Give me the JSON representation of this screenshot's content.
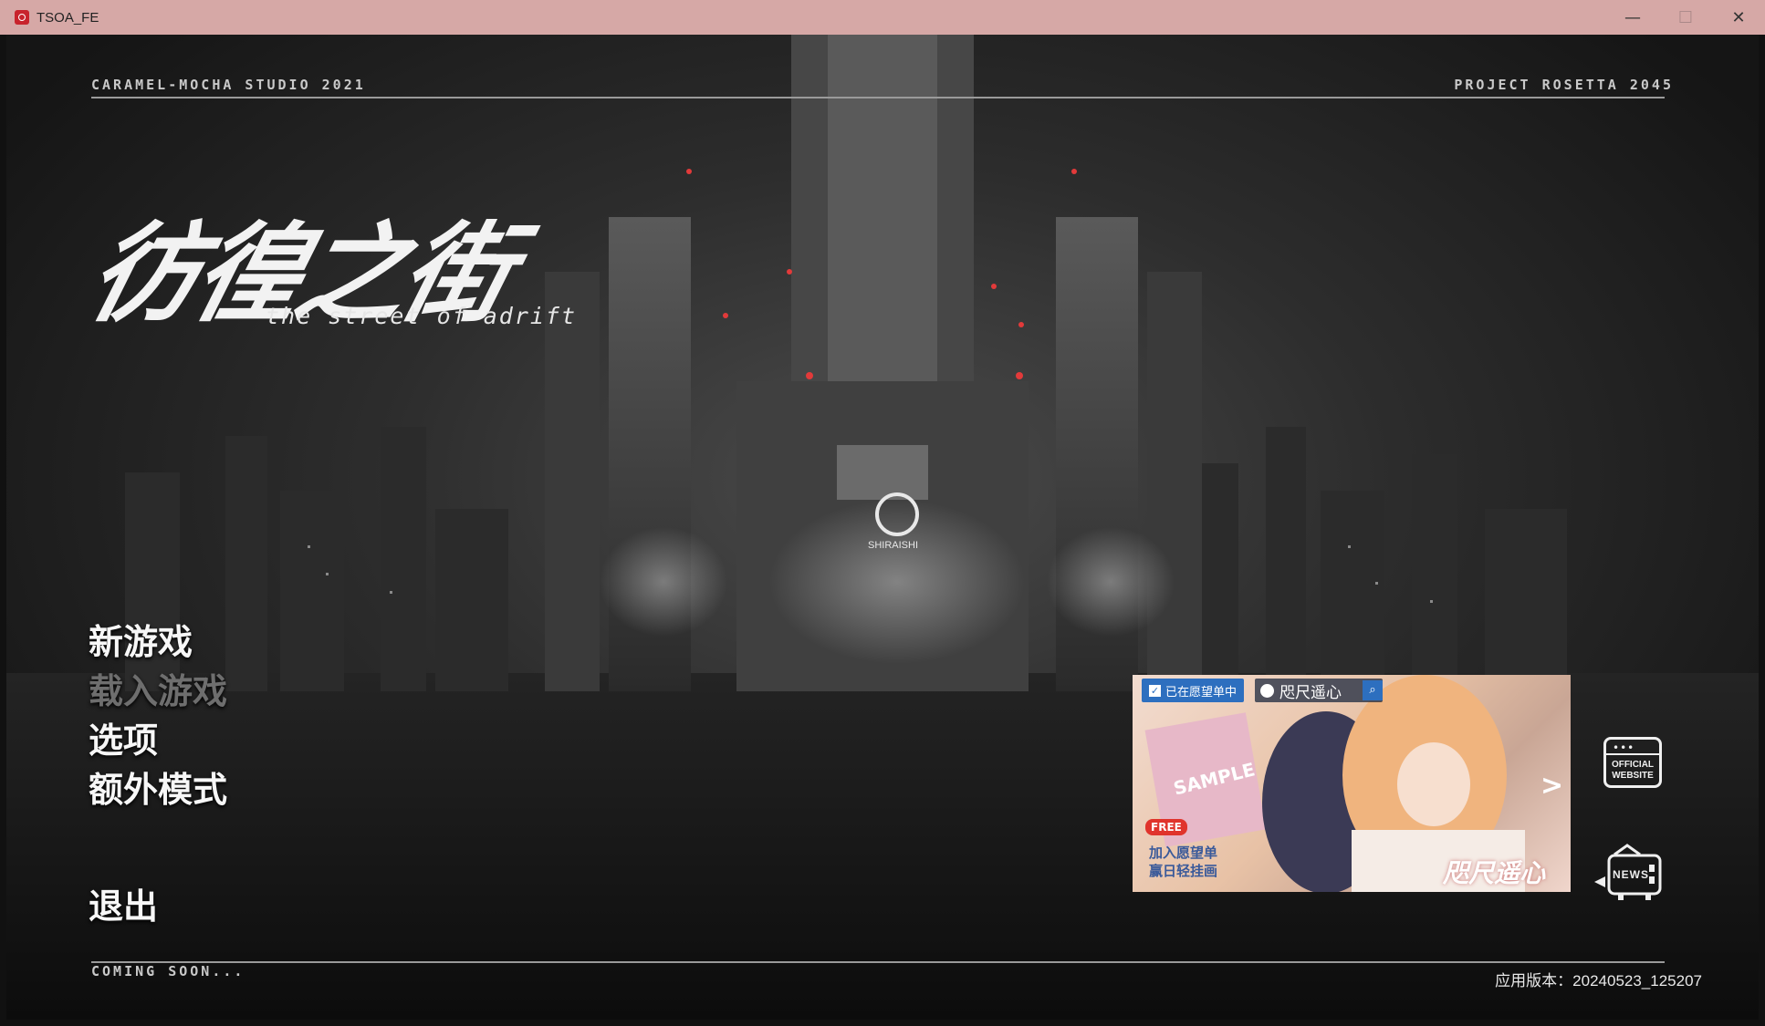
{
  "window": {
    "title": "TSOA_FE",
    "minimize_glyph": "—",
    "maximize_glyph": "☐",
    "close_glyph": "✕"
  },
  "hud": {
    "top_left": "CARAMEL-MOCHA STUDIO 2021",
    "top_right": "PROJECT ROSETTA 2045",
    "bottom_left": "COMING SOON..."
  },
  "logo": {
    "title": "彷徨之街",
    "subtitle": "the street of adrift"
  },
  "building_sign": "SHIRAISHI",
  "menu": [
    {
      "label": "新游戏",
      "enabled": true
    },
    {
      "label": "载入游戏",
      "enabled": false
    },
    {
      "label": "选项",
      "enabled": true
    },
    {
      "label": "额外模式",
      "enabled": true
    },
    {
      "label": "退出",
      "enabled": true
    }
  ],
  "ad": {
    "wishlist_label": "已在愿望单中",
    "game_name": "咫尺遥心",
    "free_badge": "FREE",
    "line1": "加入愿望单",
    "line2": "赢日轻挂画",
    "cover_text": "SAMPLE",
    "brand": "咫尺遥心",
    "arrow": ">"
  },
  "buttons": {
    "website_line1": "OFFICIAL",
    "website_line2": "WEBSITE",
    "news": "NEWS"
  },
  "version": "应用版本：20240523_125207",
  "colors": {
    "titlebar": "#d6a8a6",
    "menu_enabled": "#f7f7f7",
    "menu_disabled": "#6e6e6e",
    "accent_red": "#e23a3a"
  }
}
